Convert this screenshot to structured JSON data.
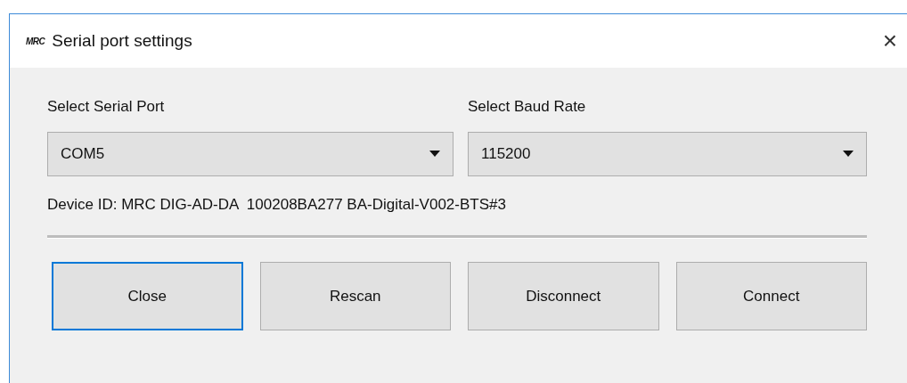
{
  "window": {
    "logo": "MRC",
    "title": "Serial port settings",
    "close": "×"
  },
  "port": {
    "label": "Select Serial Port",
    "value": "COM5"
  },
  "baud": {
    "label": "Select Baud Rate",
    "value": "115200"
  },
  "device_id": "Device ID: MRC DIG-AD-DA  100208BA277 BA-Digital-V002-BTS#3",
  "buttons": [
    {
      "label": "Close",
      "focused": true
    },
    {
      "label": "Rescan",
      "focused": false
    },
    {
      "label": "Disconnect",
      "focused": false
    },
    {
      "label": "Connect",
      "focused": false
    }
  ]
}
